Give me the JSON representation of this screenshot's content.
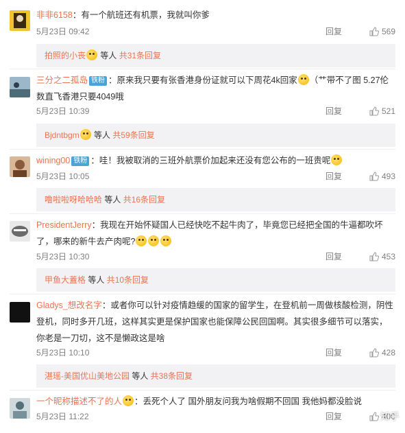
{
  "reply_label": "回复",
  "watermark": "知乎",
  "comments": [
    {
      "user": "非非6158",
      "text": "：有一个航班还有机票，我就叫你爹",
      "date": "5月23日 09:42",
      "likes": "569",
      "sub": {
        "user": "拍照的小丧",
        "mid": " 等人 ",
        "count": "共31条回复"
      }
    },
    {
      "user": "三分之二孤岛",
      "badge": "铁粉",
      "text": "：原来我只要有张香港身份证就可以下周花4k回家",
      "text2": "（艹带不了图 5.27伦数直飞香港只要4049哦",
      "date": "5月23日 10:39",
      "likes": "521",
      "sub": {
        "user": "Bjdntbgm",
        "mid": " 等人 ",
        "count": "共59条回复"
      }
    },
    {
      "user": "wining00",
      "badge": "铁粉",
      "text": "：哇！我被取消的三班外航票价加起来还没有您公布的一班贵呢",
      "date": "5月23日 10:05",
      "likes": "493",
      "sub": {
        "user": "噜啦啦呀哈哈哈",
        "mid": " 等人 ",
        "count": "共16条回复"
      }
    },
    {
      "user": "PresidentJerry",
      "text": "：我现在开始怀疑国人已经快吃不起牛肉了，毕竟您已经把全国的牛逼都吹坏了，哪来的新牛去产肉呢?",
      "date": "5月23日 10:30",
      "likes": "453",
      "sub": {
        "user": "甲鱼大蓋格",
        "mid": " 等人 ",
        "count": "共10条回复"
      }
    },
    {
      "user": "Gladys_想改名字",
      "text": "：或者你可以针对疫情趋缓的国家的留学生，在登机前一周做核酸检测，阴性登机，同时多开几班，这样其实更是保护国家也能保障公民回国啊。其实很多细节可以落实，你老是一刀切，这不是懒政这是啥",
      "date": "5月23日 10:10",
      "likes": "428",
      "sub": {
        "user": "湛瑶-美国优山美地公园",
        "mid": " 等人 ",
        "count": "共38条回复"
      }
    },
    {
      "user": "一个昵称描述不了的人",
      "text": "：丢死个人了 国外朋友问我为啥假期不回国 我他妈都没脸说",
      "date": "5月23日 11:22",
      "likes": "400"
    }
  ]
}
